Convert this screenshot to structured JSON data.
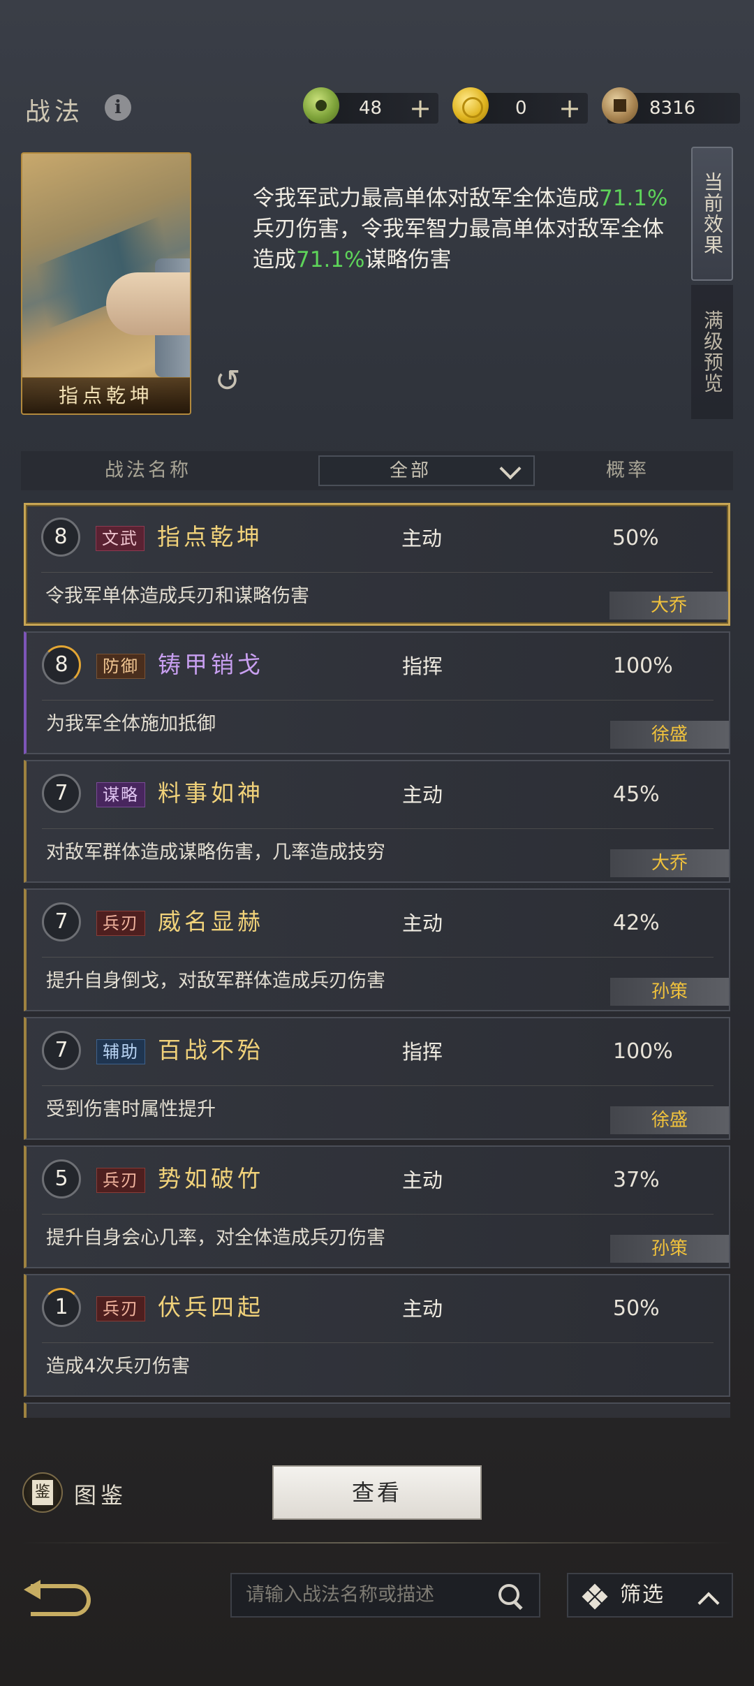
{
  "header": {
    "title": "战法",
    "info_icon": "info-icon",
    "currencies": [
      {
        "name": "jade",
        "icon": "jade-coin-icon",
        "value": "48",
        "plus": "+"
      },
      {
        "name": "gold",
        "icon": "gold-coin-icon",
        "value": "0",
        "plus": "+"
      },
      {
        "name": "copper",
        "icon": "copper-coin-icon",
        "value": "8316"
      }
    ]
  },
  "detail": {
    "card_name": "指点乾坤",
    "desc_parts": [
      "令我军武力最高单体对敌军全体造成",
      "71.1%",
      "兵刃伤害，令我军智力最高单体对敌军全体造成",
      "71.1%",
      "谋略伤害"
    ],
    "tab_current": "当前效果",
    "tab_preview": "满级预览"
  },
  "list_header": {
    "name_col": "战法名称",
    "filter": "全部",
    "rate_col": "概率"
  },
  "rows": [
    {
      "level": "8",
      "tag": "文武",
      "name": "指点乾坤",
      "type": "主动",
      "rate": "50%",
      "desc": "令我军单体造成兵刃和谋略伤害",
      "owner": "大乔"
    },
    {
      "level": "8",
      "tag": "防御",
      "name": "铸甲销戈",
      "type": "指挥",
      "rate": "100%",
      "desc": "为我军全体施加抵御",
      "owner": "徐盛"
    },
    {
      "level": "7",
      "tag": "谋略",
      "name": "料事如神",
      "type": "主动",
      "rate": "45%",
      "desc": "对敌军群体造成谋略伤害，几率造成技穷",
      "owner": "大乔"
    },
    {
      "level": "7",
      "tag": "兵刃",
      "name": "威名显赫",
      "type": "主动",
      "rate": "42%",
      "desc": "提升自身倒戈，对敌军群体造成兵刃伤害",
      "owner": "孙策"
    },
    {
      "level": "7",
      "tag": "辅助",
      "name": "百战不殆",
      "type": "指挥",
      "rate": "100%",
      "desc": "受到伤害时属性提升",
      "owner": "徐盛"
    },
    {
      "level": "5",
      "tag": "兵刃",
      "name": "势如破竹",
      "type": "主动",
      "rate": "37%",
      "desc": "提升自身会心几率，对全体造成兵刃伤害",
      "owner": "孙策"
    },
    {
      "level": "1",
      "tag": "兵刃",
      "name": "伏兵四起",
      "type": "主动",
      "rate": "50%",
      "desc": "造成4次兵刃伤害",
      "owner": ""
    }
  ],
  "footer": {
    "codex_label": "图鉴",
    "view_button": "查看",
    "search_placeholder": "请输入战法名称或描述",
    "filter_label": "筛选"
  },
  "colors": {
    "highlight_green": "#5ed45a",
    "owner_gold": "#f1c23c",
    "selected_border": "#c7a554"
  }
}
